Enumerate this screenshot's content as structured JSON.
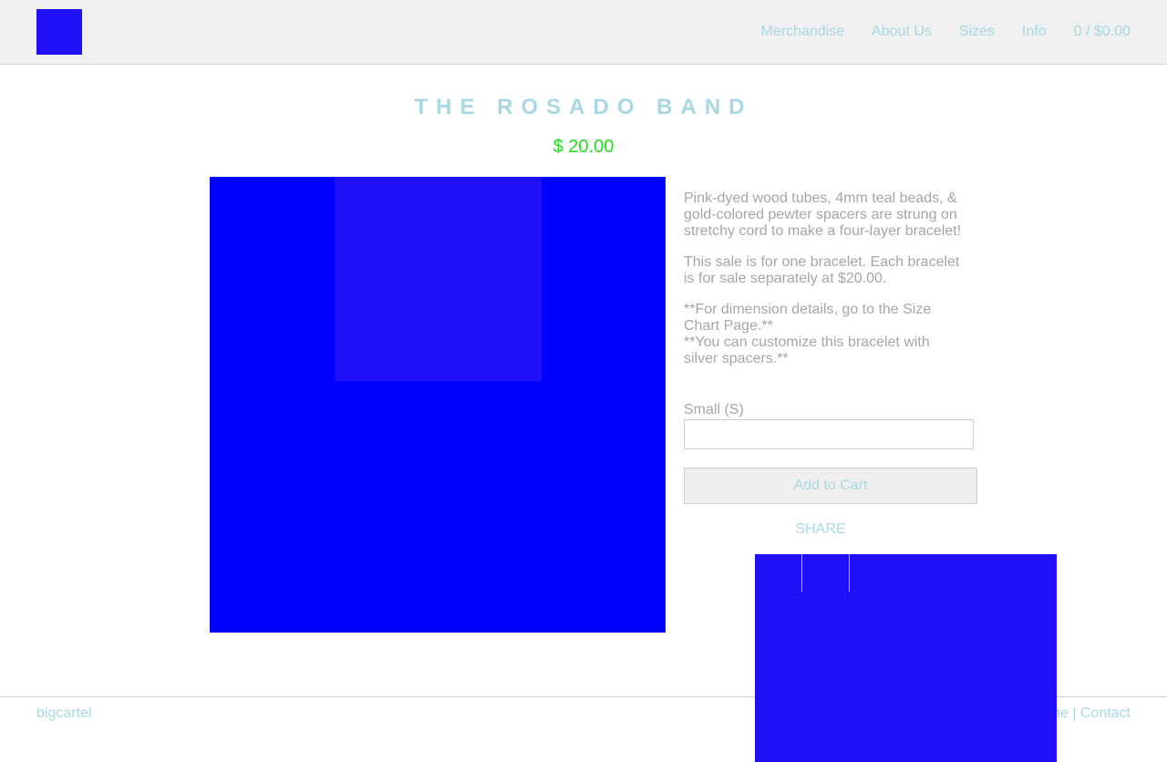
{
  "header": {
    "nav": [
      "Merchandise",
      "About Us",
      "Sizes",
      "Info",
      "0 / $0.00"
    ]
  },
  "product": {
    "title": "THE ROSADO BAND",
    "price": "$ 20.00",
    "description": [
      "Pink-dyed wood tubes, 4mm teal beads, & gold-colored pewter spacers are strung on stretchy cord to make a four-layer bracelet!",
      "This sale is for one bracelet. Each bracelet is for sale separately at $20.00.",
      "**For dimension details, go to the Size Chart Page.**",
      "**You can customize this bracelet with silver spacers.**"
    ],
    "size_label": "Small (S)",
    "size_value": "",
    "add_to_cart": "Add to Cart",
    "share_label": "SHARE"
  },
  "footer": {
    "brand": "bigcartel",
    "home": "Home",
    "separator": " | ",
    "contact": "Contact"
  },
  "colors": {
    "accent": "#a8d8e2",
    "price": "#22dd22",
    "placeholder_blue": "#0000ff",
    "placeholder_violet": "#2010f5"
  }
}
